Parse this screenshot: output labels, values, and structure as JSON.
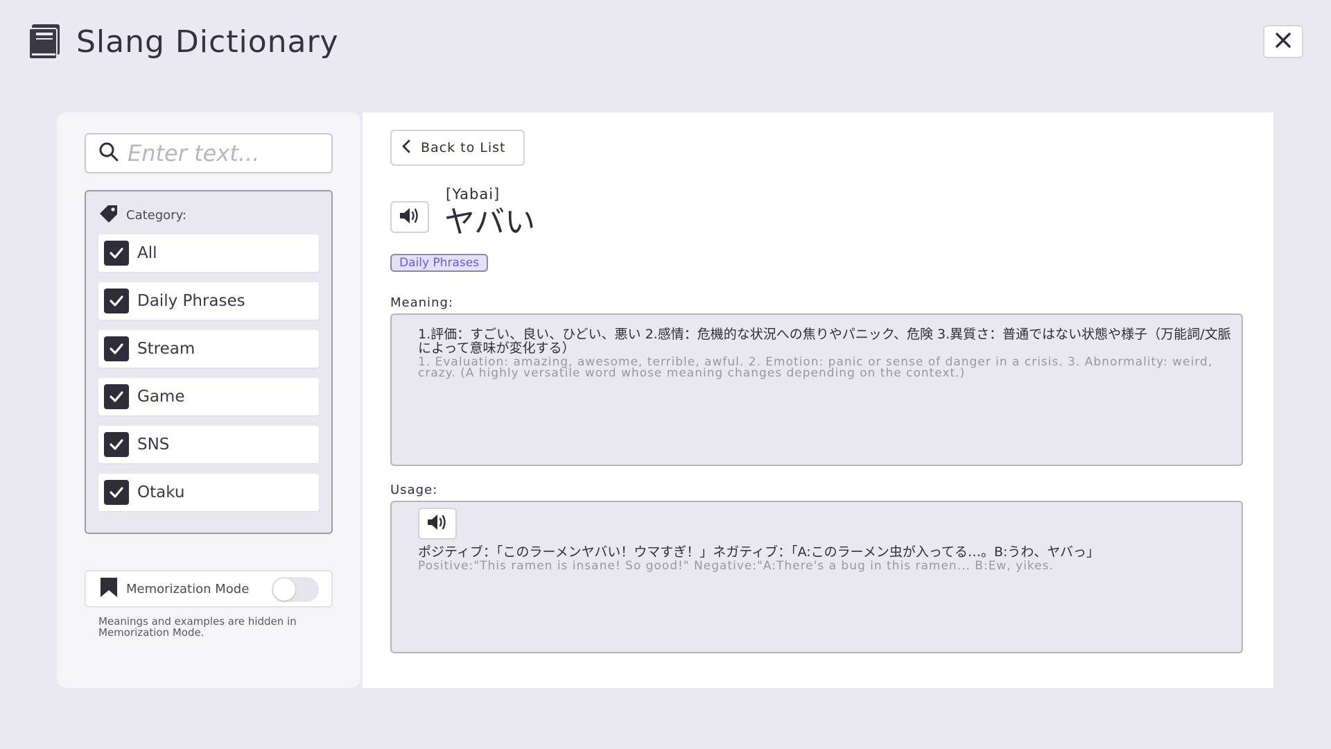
{
  "app": {
    "title": "Slang Dictionary",
    "close_icon": "close-icon"
  },
  "sidebar": {
    "search": {
      "placeholder": "Enter text...",
      "value": ""
    },
    "category": {
      "label": "Category:",
      "items": [
        {
          "label": "All",
          "checked": true
        },
        {
          "label": "Daily Phrases",
          "checked": true
        },
        {
          "label": "Stream",
          "checked": true
        },
        {
          "label": "Game",
          "checked": true
        },
        {
          "label": "SNS",
          "checked": true
        },
        {
          "label": "Otaku",
          "checked": true
        }
      ]
    },
    "memorization": {
      "label": "Memorization Mode",
      "enabled": false,
      "note": "Meanings and examples are hidden in Memorization Mode."
    }
  },
  "detail": {
    "back_label": "Back to List",
    "reading": "[Yabai]",
    "term": "ヤバい",
    "tag": "Daily Phrases",
    "meaning": {
      "label": "Meaning:",
      "jp": "1.評価：すごい、良い、ひどい、悪い 2.感情：危機的な状況への焦りやパニック、危険 3.異質さ：普通ではない状態や様子（万能詞/文脈によって意味が変化する）",
      "en": "1. Evaluation: amazing, awesome, terrible, awful. 2. Emotion: panic or sense of danger in a crisis. 3. Abnormality: weird, crazy. (A highly versatile word whose meaning changes depending on the context.)"
    },
    "usage": {
      "label": "Usage:",
      "jp": "ポジティブ：「このラーメンヤバい！ウマすぎ！」ネガティブ：「A:このラーメン虫が入ってる…。B:うわ、ヤバっ」",
      "en": "Positive:\"This ramen is insane! So good!\" Negative:\"A:There's a bug in this ramen... B:Ew, yikes."
    }
  },
  "colors": {
    "background": "#eae8f1",
    "checkbox": "#2e2d3a",
    "tag_text": "#6a5ad6",
    "tag_bg": "#e3e0f7"
  }
}
